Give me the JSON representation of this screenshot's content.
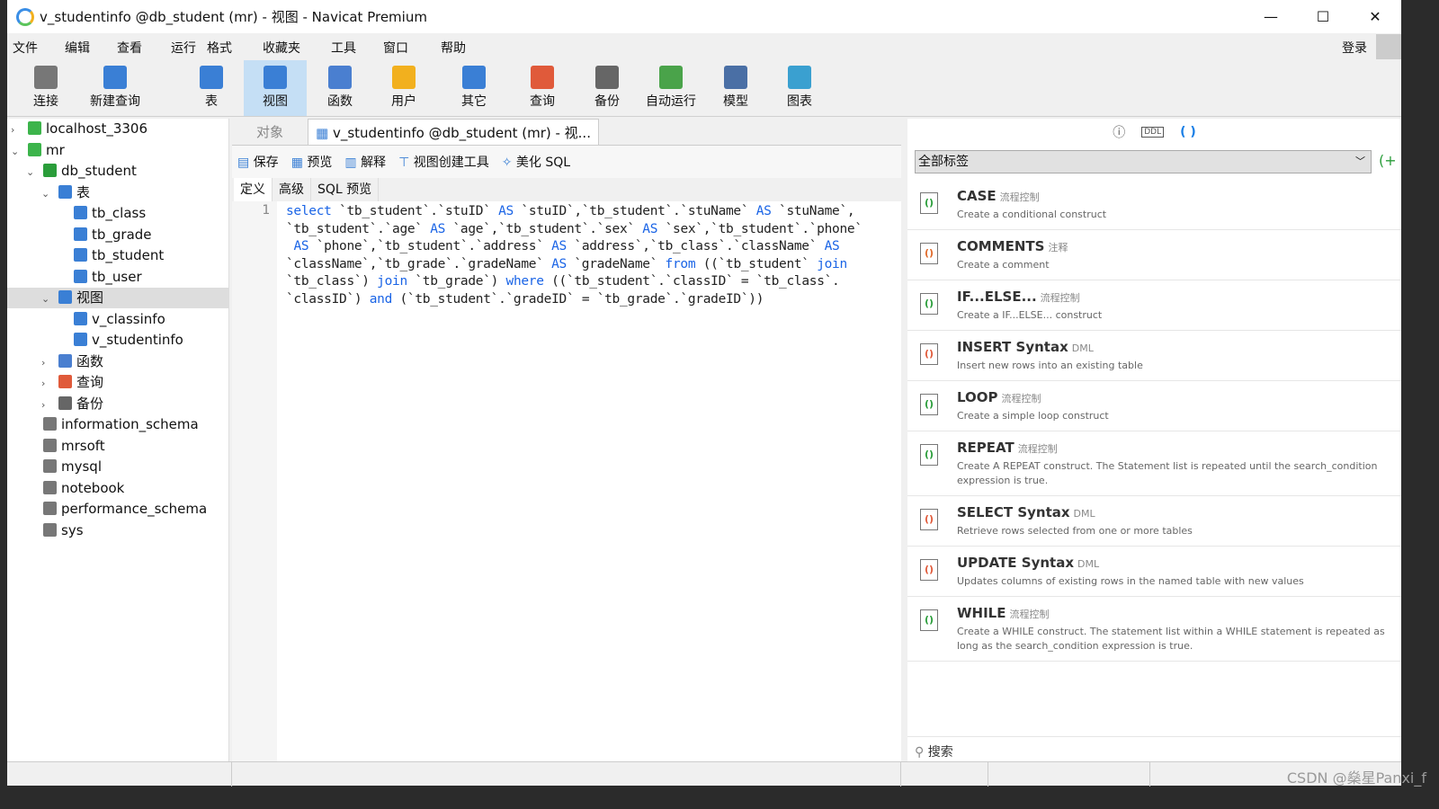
{
  "window": {
    "title": "v_studentinfo @db_student (mr) - 视图 - Navicat Premium",
    "minimize": "—",
    "maximize": "☐",
    "close": "✕"
  },
  "menu": [
    "文件",
    "编辑",
    "查看",
    "运行",
    "格式",
    "收藏夹",
    "工具",
    "窗口",
    "帮助"
  ],
  "login": "登录",
  "toolbar": [
    {
      "label": "连接",
      "icon": "connect-icon",
      "color": "#777"
    },
    {
      "label": "新建查询",
      "icon": "new-query-icon",
      "color": "#3a7fd5"
    },
    {
      "label": "表",
      "icon": "table-icon",
      "color": "#3a7fd5"
    },
    {
      "label": "视图",
      "icon": "view-icon",
      "color": "#3a7fd5",
      "active": true
    },
    {
      "label": "函数",
      "icon": "function-icon",
      "color": "#4a7fd0"
    },
    {
      "label": "用户",
      "icon": "user-icon",
      "color": "#f2b01e"
    },
    {
      "label": "其它",
      "icon": "tools-icon",
      "color": "#3a7fd5"
    },
    {
      "label": "查询",
      "icon": "query-icon",
      "color": "#e05a3a"
    },
    {
      "label": "备份",
      "icon": "backup-icon",
      "color": "#666"
    },
    {
      "label": "自动运行",
      "icon": "schedule-icon",
      "color": "#4aa34a"
    },
    {
      "label": "模型",
      "icon": "model-icon",
      "color": "#4a6fa5"
    },
    {
      "label": "图表",
      "icon": "chart-icon",
      "color": "#3aa0d0"
    }
  ],
  "tree": [
    {
      "label": "localhost_3306",
      "level": 0,
      "tw": ">",
      "icon": "#3cb44b"
    },
    {
      "label": "mr",
      "level": 0,
      "tw": "v",
      "icon": "#3cb44b"
    },
    {
      "label": "db_student",
      "level": 1,
      "tw": "v",
      "icon": "#2a9d3a"
    },
    {
      "label": "表",
      "level": 2,
      "tw": "v",
      "icon": "#3a7fd5"
    },
    {
      "label": "tb_class",
      "level": 3,
      "tw": "",
      "icon": "#3a7fd5"
    },
    {
      "label": "tb_grade",
      "level": 3,
      "tw": "",
      "icon": "#3a7fd5"
    },
    {
      "label": "tb_student",
      "level": 3,
      "tw": "",
      "icon": "#3a7fd5"
    },
    {
      "label": "tb_user",
      "level": 3,
      "tw": "",
      "icon": "#3a7fd5"
    },
    {
      "label": "视图",
      "level": 2,
      "tw": "v",
      "icon": "#3a7fd5",
      "selected": true
    },
    {
      "label": "v_classinfo",
      "level": 3,
      "tw": "",
      "icon": "#3a7fd5"
    },
    {
      "label": "v_studentinfo",
      "level": 3,
      "tw": "",
      "icon": "#3a7fd5"
    },
    {
      "label": "函数",
      "level": 2,
      "tw": ">",
      "icon": "#4a7fd0"
    },
    {
      "label": "查询",
      "level": 2,
      "tw": ">",
      "icon": "#e05a3a"
    },
    {
      "label": "备份",
      "level": 2,
      "tw": ">",
      "icon": "#666"
    },
    {
      "label": "information_schema",
      "level": 1,
      "tw": "",
      "icon": "#777"
    },
    {
      "label": "mrsoft",
      "level": 1,
      "tw": "",
      "icon": "#777"
    },
    {
      "label": "mysql",
      "level": 1,
      "tw": "",
      "icon": "#777"
    },
    {
      "label": "notebook",
      "level": 1,
      "tw": "",
      "icon": "#777"
    },
    {
      "label": "performance_schema",
      "level": 1,
      "tw": "",
      "icon": "#777"
    },
    {
      "label": "sys",
      "level": 1,
      "tw": "",
      "icon": "#777"
    }
  ],
  "tabs": {
    "objects": "对象",
    "current": "v_studentinfo @db_student (mr) - 视..."
  },
  "editor_toolbar": [
    "保存",
    "预览",
    "解释",
    "视图创建工具",
    "美化 SQL"
  ],
  "subtabs": [
    "定义",
    "高级",
    "SQL 预览"
  ],
  "editor": {
    "line_numbers": [
      "1"
    ],
    "keywords": [
      "select",
      "AS",
      "from",
      "join",
      "where",
      "and"
    ],
    "lines": [
      "select `tb_student`.`stuID` AS `stuID`,`tb_student`.`stuName` AS `stuName`,",
      "`tb_student`.`age` AS `age`,`tb_student`.`sex` AS `sex`,`tb_student`.`phone`",
      " AS `phone`,`tb_student`.`address` AS `address`,`tb_class`.`className` AS",
      "`className`,`tb_grade`.`gradeName` AS `gradeName` from ((`tb_student` join",
      "`tb_class`) join `tb_grade`) where ((`tb_student`.`classID` = `tb_class`.",
      "`classID`) and (`tb_student`.`gradeID` = `tb_grade`.`gradeID`))"
    ]
  },
  "right_panel": {
    "tag_filter": "全部标签",
    "search_placeholder": "搜索",
    "snippets": [
      {
        "name": "CASE",
        "tag": "流程控制",
        "desc": "Create a conditional construct"
      },
      {
        "name": "COMMENTS",
        "tag": "注释",
        "desc": "Create a comment"
      },
      {
        "name": "IF...ELSE...",
        "tag": "流程控制",
        "desc": "Create a IF...ELSE... construct"
      },
      {
        "name": "INSERT Syntax",
        "tag": "DML",
        "desc": "Insert new rows into an existing table"
      },
      {
        "name": "LOOP",
        "tag": "流程控制",
        "desc": "Create a simple loop construct"
      },
      {
        "name": "REPEAT",
        "tag": "流程控制",
        "desc": "Create A REPEAT construct. The Statement list is repeated until the search_condition expression is true."
      },
      {
        "name": "SELECT Syntax",
        "tag": "DML",
        "desc": "Retrieve rows selected from one or more tables"
      },
      {
        "name": "UPDATE Syntax",
        "tag": "DML",
        "desc": "Updates columns of existing rows in the named table with new values"
      },
      {
        "name": "WHILE",
        "tag": "流程控制",
        "desc": "Create a WHILE construct. The statement list within a WHILE statement is repeated as long as the search_condition expression is true."
      }
    ]
  },
  "watermark": "CSDN @燊星Panxi_f"
}
